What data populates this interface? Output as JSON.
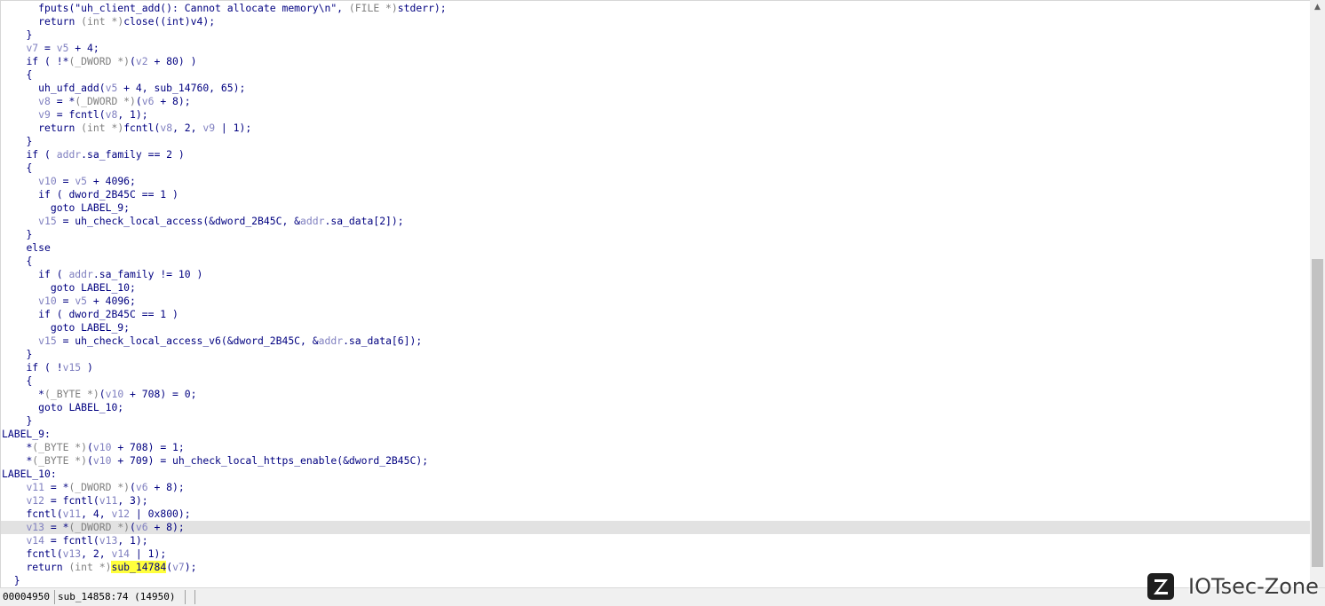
{
  "code_lines": [
    {
      "indent": "      ",
      "segments": [
        [
          "k",
          "fputs(\"uh_client_add(): Cannot allocate memory\\n\", "
        ],
        [
          "t",
          "(FILE *)"
        ],
        [
          "k",
          "stderr);"
        ]
      ]
    },
    {
      "indent": "      ",
      "segments": [
        [
          "k",
          "return "
        ],
        [
          "t",
          "(int *)"
        ],
        [
          "k",
          "close(("
        ],
        [
          "k",
          "int"
        ],
        [
          "k",
          ")v4);"
        ]
      ]
    },
    {
      "indent": "    ",
      "segments": [
        [
          "k",
          "}"
        ]
      ]
    },
    {
      "indent": "    ",
      "segments": [
        [
          "v",
          "v7"
        ],
        [
          "k",
          " = "
        ],
        [
          "v",
          "v5"
        ],
        [
          "k",
          " + 4;"
        ]
      ]
    },
    {
      "indent": "    ",
      "segments": [
        [
          "k",
          "if ( !*"
        ],
        [
          "t",
          "(_DWORD *)"
        ],
        [
          "k",
          "("
        ],
        [
          "v",
          "v2"
        ],
        [
          "k",
          " + 80) )"
        ]
      ]
    },
    {
      "indent": "    ",
      "segments": [
        [
          "k",
          "{"
        ]
      ]
    },
    {
      "indent": "      ",
      "segments": [
        [
          "k",
          "uh_ufd_add("
        ],
        [
          "v",
          "v5"
        ],
        [
          "k",
          " + 4, sub_14760, 65);"
        ]
      ]
    },
    {
      "indent": "      ",
      "segments": [
        [
          "v",
          "v8"
        ],
        [
          "k",
          " = *"
        ],
        [
          "t",
          "(_DWORD *)"
        ],
        [
          "k",
          "("
        ],
        [
          "v",
          "v6"
        ],
        [
          "k",
          " + 8);"
        ]
      ]
    },
    {
      "indent": "      ",
      "segments": [
        [
          "v",
          "v9"
        ],
        [
          "k",
          " = fcntl("
        ],
        [
          "v",
          "v8"
        ],
        [
          "k",
          ", 1);"
        ]
      ]
    },
    {
      "indent": "      ",
      "segments": [
        [
          "k",
          "return "
        ],
        [
          "t",
          "(int *)"
        ],
        [
          "k",
          "fcntl("
        ],
        [
          "v",
          "v8"
        ],
        [
          "k",
          ", 2, "
        ],
        [
          "v",
          "v9"
        ],
        [
          "k",
          " | 1);"
        ]
      ]
    },
    {
      "indent": "    ",
      "segments": [
        [
          "k",
          "}"
        ]
      ]
    },
    {
      "indent": "    ",
      "segments": [
        [
          "k",
          "if ( "
        ],
        [
          "v",
          "addr"
        ],
        [
          "k",
          ".sa_family == 2 )"
        ]
      ]
    },
    {
      "indent": "    ",
      "segments": [
        [
          "k",
          "{"
        ]
      ]
    },
    {
      "indent": "      ",
      "segments": [
        [
          "v",
          "v10"
        ],
        [
          "k",
          " = "
        ],
        [
          "v",
          "v5"
        ],
        [
          "k",
          " + 4096;"
        ]
      ]
    },
    {
      "indent": "      ",
      "segments": [
        [
          "k",
          "if ( dword_2B45C == 1 )"
        ]
      ]
    },
    {
      "indent": "        ",
      "segments": [
        [
          "k",
          "goto LABEL_9;"
        ]
      ]
    },
    {
      "indent": "      ",
      "segments": [
        [
          "v",
          "v15"
        ],
        [
          "k",
          " = uh_check_local_access(&dword_2B45C, &"
        ],
        [
          "v",
          "addr"
        ],
        [
          "k",
          ".sa_data[2]);"
        ]
      ]
    },
    {
      "indent": "    ",
      "segments": [
        [
          "k",
          "}"
        ]
      ]
    },
    {
      "indent": "    ",
      "segments": [
        [
          "k",
          "else"
        ]
      ]
    },
    {
      "indent": "    ",
      "segments": [
        [
          "k",
          "{"
        ]
      ]
    },
    {
      "indent": "      ",
      "segments": [
        [
          "k",
          "if ( "
        ],
        [
          "v",
          "addr"
        ],
        [
          "k",
          ".sa_family != 10 )"
        ]
      ]
    },
    {
      "indent": "        ",
      "segments": [
        [
          "k",
          "goto LABEL_10;"
        ]
      ]
    },
    {
      "indent": "      ",
      "segments": [
        [
          "v",
          "v10"
        ],
        [
          "k",
          " = "
        ],
        [
          "v",
          "v5"
        ],
        [
          "k",
          " + 4096;"
        ]
      ]
    },
    {
      "indent": "      ",
      "segments": [
        [
          "k",
          "if ( dword_2B45C == 1 )"
        ]
      ]
    },
    {
      "indent": "        ",
      "segments": [
        [
          "k",
          "goto LABEL_9;"
        ]
      ]
    },
    {
      "indent": "      ",
      "segments": [
        [
          "v",
          "v15"
        ],
        [
          "k",
          " = uh_check_local_access_v6(&dword_2B45C, &"
        ],
        [
          "v",
          "addr"
        ],
        [
          "k",
          ".sa_data[6]);"
        ]
      ]
    },
    {
      "indent": "    ",
      "segments": [
        [
          "k",
          "}"
        ]
      ]
    },
    {
      "indent": "    ",
      "segments": [
        [
          "k",
          "if ( !"
        ],
        [
          "v",
          "v15"
        ],
        [
          "k",
          " )"
        ]
      ]
    },
    {
      "indent": "    ",
      "segments": [
        [
          "k",
          "{"
        ]
      ]
    },
    {
      "indent": "      ",
      "segments": [
        [
          "k",
          "*"
        ],
        [
          "t",
          "(_BYTE *)"
        ],
        [
          "k",
          "("
        ],
        [
          "v",
          "v10"
        ],
        [
          "k",
          " + 708) = 0;"
        ]
      ]
    },
    {
      "indent": "      ",
      "segments": [
        [
          "k",
          "goto LABEL_10;"
        ]
      ]
    },
    {
      "indent": "    ",
      "segments": [
        [
          "k",
          "}"
        ]
      ]
    },
    {
      "indent": "",
      "segments": [
        [
          "k",
          "LABEL_9:"
        ]
      ]
    },
    {
      "indent": "    ",
      "segments": [
        [
          "k",
          "*"
        ],
        [
          "t",
          "(_BYTE *)"
        ],
        [
          "k",
          "("
        ],
        [
          "v",
          "v10"
        ],
        [
          "k",
          " + 708) = 1;"
        ]
      ]
    },
    {
      "indent": "    ",
      "segments": [
        [
          "k",
          "*"
        ],
        [
          "t",
          "(_BYTE *)"
        ],
        [
          "k",
          "("
        ],
        [
          "v",
          "v10"
        ],
        [
          "k",
          " + 709) = uh_check_local_https_enable(&dword_2B45C);"
        ]
      ]
    },
    {
      "indent": "",
      "segments": [
        [
          "k",
          "LABEL_10:"
        ]
      ]
    },
    {
      "indent": "    ",
      "segments": [
        [
          "v",
          "v11"
        ],
        [
          "k",
          " = *"
        ],
        [
          "t",
          "(_DWORD *)"
        ],
        [
          "k",
          "("
        ],
        [
          "v",
          "v6"
        ],
        [
          "k",
          " + 8);"
        ]
      ]
    },
    {
      "indent": "    ",
      "segments": [
        [
          "v",
          "v12"
        ],
        [
          "k",
          " = fcntl("
        ],
        [
          "v",
          "v11"
        ],
        [
          "k",
          ", 3);"
        ]
      ]
    },
    {
      "indent": "    ",
      "segments": [
        [
          "k",
          "fcntl("
        ],
        [
          "v",
          "v11"
        ],
        [
          "k",
          ", 4, "
        ],
        [
          "v",
          "v12"
        ],
        [
          "k",
          " | 0x800);"
        ]
      ]
    },
    {
      "indent": "    ",
      "current": true,
      "segments": [
        [
          "v",
          "v13"
        ],
        [
          "k",
          " = *"
        ],
        [
          "t",
          "(_DWORD *)"
        ],
        [
          "k",
          "("
        ],
        [
          "v",
          "v6"
        ],
        [
          "k",
          " + 8);"
        ]
      ]
    },
    {
      "indent": "    ",
      "segments": [
        [
          "v",
          "v14"
        ],
        [
          "k",
          " = fcntl("
        ],
        [
          "v",
          "v13"
        ],
        [
          "k",
          ", 1);"
        ]
      ]
    },
    {
      "indent": "    ",
      "segments": [
        [
          "k",
          "fcntl("
        ],
        [
          "v",
          "v13"
        ],
        [
          "k",
          ", 2, "
        ],
        [
          "v",
          "v14"
        ],
        [
          "k",
          " | 1);"
        ]
      ]
    },
    {
      "indent": "    ",
      "segments": [
        [
          "k",
          "return "
        ],
        [
          "t",
          "(int *)"
        ],
        [
          "hl",
          "sub_14784"
        ],
        [
          "k",
          "("
        ],
        [
          "v",
          "v7"
        ],
        [
          "k",
          ");"
        ]
      ]
    },
    {
      "indent": "  ",
      "segments": [
        [
          "k",
          "}"
        ]
      ]
    }
  ],
  "status_bar": {
    "address": "00004950",
    "function_position": "sub_14858:74 (14950)"
  },
  "watermark": {
    "logo_letter": "Z",
    "text": "IOTsec-Zone"
  },
  "colors": {
    "keyword": "#000080",
    "variable": "#8080c0",
    "type_cast": "#808080",
    "highlight": "#ffff3c",
    "current_line": "#e2e2e2"
  },
  "icons": {
    "scroll_up": "chevron-up-icon"
  }
}
